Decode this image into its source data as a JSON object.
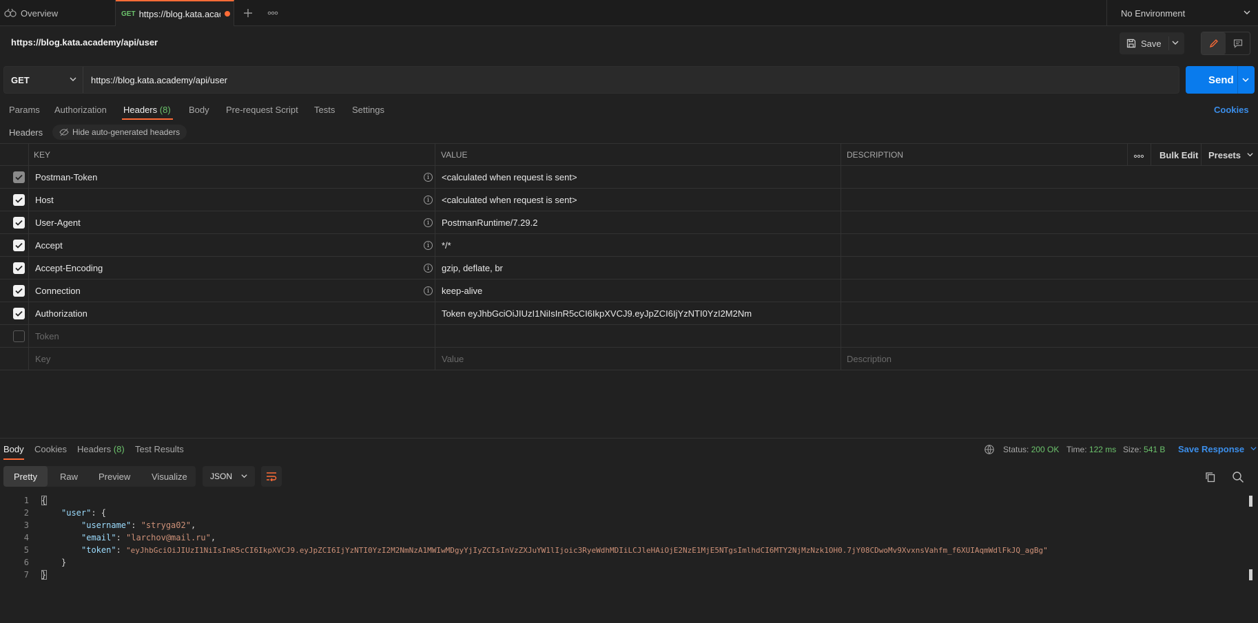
{
  "tabs": {
    "overview_label": "Overview",
    "active_method": "GET",
    "active_title": "https://blog.kata.academy/api/user",
    "environment": "No Environment"
  },
  "request": {
    "title": "https://blog.kata.academy/api/user",
    "save_label": "Save",
    "method": "GET",
    "url": "https://blog.kata.academy/api/user",
    "send_label": "Send"
  },
  "request_tabs": [
    {
      "label": "Params"
    },
    {
      "label": "Authorization"
    },
    {
      "label": "Headers",
      "count": "(8)"
    },
    {
      "label": "Body"
    },
    {
      "label": "Pre-request Script"
    },
    {
      "label": "Tests"
    },
    {
      "label": "Settings"
    }
  ],
  "cookies_label": "Cookies",
  "headers_section": {
    "label": "Headers",
    "hide_chip": "Hide auto-generated headers",
    "columns": {
      "key": "KEY",
      "value": "VALUE",
      "description": "DESCRIPTION"
    },
    "bulk_edit": "Bulk Edit",
    "presets": "Presets",
    "rows": [
      {
        "key": "Postman-Token",
        "value": "<calculated when request is sent>"
      },
      {
        "key": "Host",
        "value": "<calculated when request is sent>"
      },
      {
        "key": "User-Agent",
        "value": "PostmanRuntime/7.29.2"
      },
      {
        "key": "Accept",
        "value": "*/*"
      },
      {
        "key": "Accept-Encoding",
        "value": "gzip, deflate, br"
      },
      {
        "key": "Connection",
        "value": "keep-alive"
      },
      {
        "key": "Authorization",
        "value": "Token eyJhbGciOiJIUzI1NiIsInR5cCI6IkpXVCJ9.eyJpZCI6IjYzNTI0YzI2M2Nm"
      },
      {
        "key": "Token",
        "value": ""
      }
    ],
    "placeholders": {
      "key": "Key",
      "value": "Value",
      "description": "Description"
    }
  },
  "response": {
    "tabs": [
      {
        "label": "Body"
      },
      {
        "label": "Cookies"
      },
      {
        "label": "Headers",
        "count": "(8)"
      },
      {
        "label": "Test Results"
      }
    ],
    "status_label": "Status:",
    "status_value": "200 OK",
    "time_label": "Time:",
    "time_value": "122 ms",
    "size_label": "Size:",
    "size_value": "541 B",
    "save_response": "Save Response",
    "views": [
      "Pretty",
      "Raw",
      "Preview",
      "Visualize"
    ],
    "format": "JSON",
    "body": {
      "line_numbers": [
        "1",
        "2",
        "3",
        "4",
        "5",
        "6",
        "7"
      ],
      "user_key": "\"user\"",
      "username_key": "\"username\"",
      "username_value": "\"stryga02\"",
      "email_key": "\"email\"",
      "email_value": "\"larchov@mail.ru\"",
      "token_key": "\"token\"",
      "token_value": "\"eyJhbGciOiJIUzI1NiIsInR5cCI6IkpXVCJ9.eyJpZCI6IjYzNTI0YzI2M2NmNzA1MWIwMDgyYjIyZCIsInVzZXJuYW1lIjoic3RyeWdhMDIiLCJleHAiOjE2NzE1MjE5NTgsImlhdCI6MTY2NjMzNzk1OH0.7jY08CDwoMv9XvxnsVahfm_f6XUIAqmWdlFkJQ_agBg\""
    }
  },
  "colors": {
    "accent": "#ff6c37",
    "primary": "#097bed",
    "success": "#6cc36c",
    "link": "#3b8eea"
  }
}
